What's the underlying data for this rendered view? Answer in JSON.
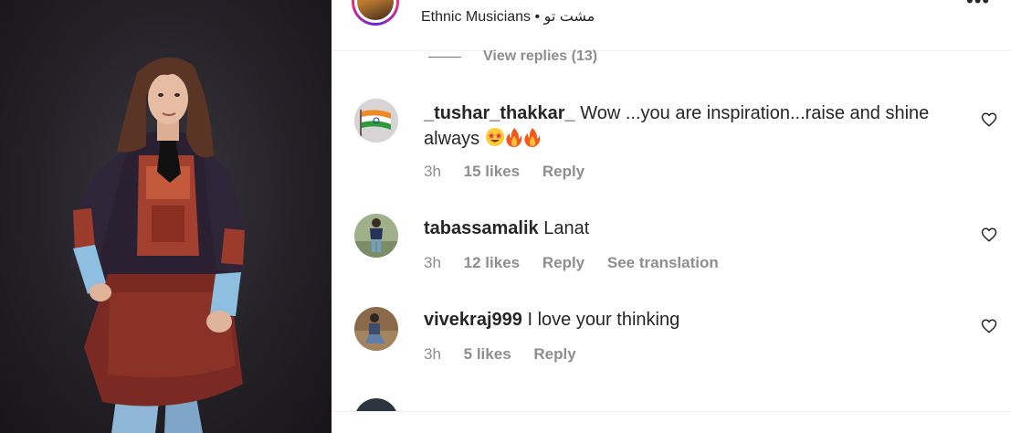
{
  "header": {
    "account_name": "Ethnic Musicians",
    "separator": "•",
    "location": "مشت تو",
    "more_icon": "more-options-icon"
  },
  "view_replies": {
    "label": "View replies (13)"
  },
  "comments": [
    {
      "username": "_tushar_thakkar_",
      "text": "Wow ...you are inspiration...raise and shine always",
      "emojis": [
        "star-struck-emoji",
        "fire-emoji",
        "fire-emoji"
      ],
      "time": "3h",
      "likes": "15 likes",
      "reply": "Reply"
    },
    {
      "username": "tabassamalik",
      "text": "Lanat",
      "time": "3h",
      "likes": "12 likes",
      "reply": "Reply",
      "translation": "See translation"
    },
    {
      "username": "vivekraj999",
      "text": "I love your thinking",
      "time": "3h",
      "likes": "5 likes",
      "reply": "Reply"
    }
  ],
  "colors": {
    "text": "#262626",
    "secondary": "#8e8e8e",
    "divider": "#efefef",
    "media_bg": "#242127"
  }
}
